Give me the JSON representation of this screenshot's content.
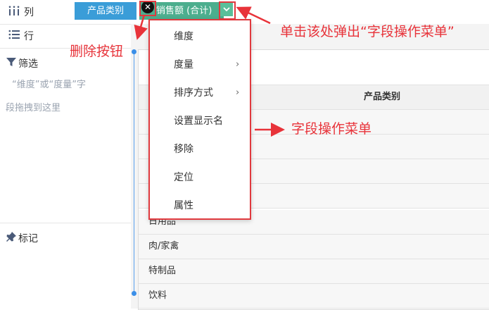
{
  "left_panel": {
    "columns_label": "列",
    "rows_label": "行",
    "filter_label": "筛选",
    "filter_hint_line1": "“维度”或“度量”字",
    "filter_hint_line2": "段拖拽到这里",
    "marks_label": "标记"
  },
  "shelf": {
    "category_pill": "产品类别",
    "sales_pill": "销售额 (合计)",
    "delete_glyph": "✕",
    "dropdown_glyph": "⌄"
  },
  "table": {
    "header": "产品类别",
    "rows": [
      "日用品",
      "肉/家禽",
      "特制品",
      "饮料"
    ]
  },
  "menu": {
    "items": [
      {
        "label": "维度",
        "submenu": false
      },
      {
        "label": "度量",
        "submenu": true
      },
      {
        "label": "排序方式",
        "submenu": true
      },
      {
        "label": "设置显示名",
        "submenu": false
      },
      {
        "label": "移除",
        "submenu": false
      },
      {
        "label": "定位",
        "submenu": false
      },
      {
        "label": "属性",
        "submenu": false
      }
    ],
    "submenu_glyph": "›"
  },
  "annotations": {
    "delete_button": "删除按钮",
    "click_popup": "单击该处弹出“字段操作菜单”",
    "field_menu": "字段操作菜单"
  },
  "colors": {
    "category_pill": "#3a9dd8",
    "sales_pill": "#4cae8e",
    "annotation_red": "#e8333a"
  }
}
